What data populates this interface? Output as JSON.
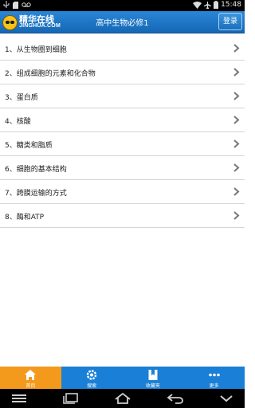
{
  "status_bar": {
    "time": "15:48",
    "left_icons": [
      "usb-icon",
      "sd-card-icon",
      "voicemail-icon"
    ],
    "right_icons": [
      "wifi-icon",
      "airplane-icon",
      "battery-icon"
    ]
  },
  "header": {
    "logo_cn": "精华在线",
    "logo_en": "JINGHUA.COM",
    "title": "高中生物必修1",
    "login_label": "登录"
  },
  "chapters": [
    {
      "label": "1、从生物圈到细胞"
    },
    {
      "label": "2、组成细胞的元素和化合物"
    },
    {
      "label": "3、蛋白质"
    },
    {
      "label": "4、核酸"
    },
    {
      "label": "5、糖类和脂质"
    },
    {
      "label": "6、细胞的基本结构"
    },
    {
      "label": "7、跨膜运输的方式"
    },
    {
      "label": "8、酶和ATP"
    }
  ],
  "bottom_nav": {
    "tabs": [
      {
        "label": "首页",
        "icon": "home-icon",
        "active": true
      },
      {
        "label": "搜索",
        "icon": "gear-icon",
        "active": false
      },
      {
        "label": "收藏夹",
        "icon": "bookmark-icon",
        "active": false
      },
      {
        "label": "更多",
        "icon": "more-icon",
        "active": false
      }
    ]
  },
  "colors": {
    "header_blue": "#1a74c4",
    "nav_blue": "#1a7fd6",
    "nav_active": "#f39a1c"
  }
}
